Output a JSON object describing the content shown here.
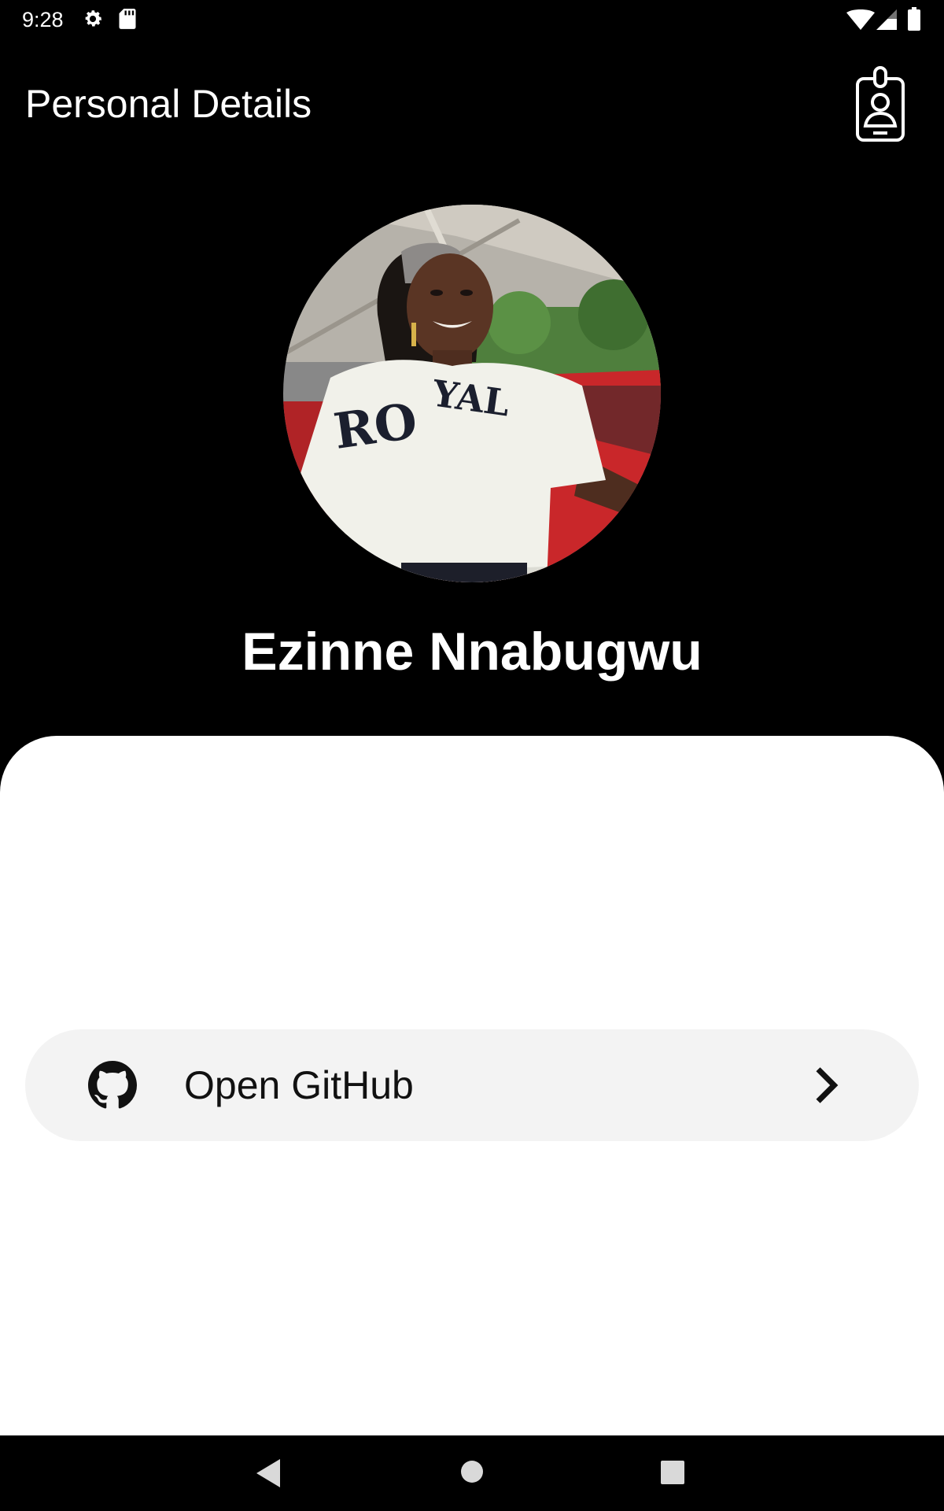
{
  "status_bar": {
    "time": "9:28",
    "icons": [
      "gear-icon",
      "sd-card-icon",
      "wifi-icon",
      "signal-icon",
      "battery-icon"
    ]
  },
  "app_bar": {
    "title": "Personal Details",
    "action_icon": "id-badge-icon"
  },
  "profile": {
    "name": "Ezinne Nnabugwu",
    "shirt_text": "ROYAL"
  },
  "actions": {
    "github": {
      "label": "Open GitHub",
      "icon": "github-icon",
      "trailing_icon": "chevron-right-icon"
    }
  },
  "nav_bar": {
    "icons": [
      "back-icon",
      "home-icon",
      "recents-icon"
    ]
  },
  "colors": {
    "background": "#000000",
    "card": "#ffffff",
    "row": "#f3f3f3",
    "text_dark": "#111111",
    "text_light": "#ffffff"
  }
}
